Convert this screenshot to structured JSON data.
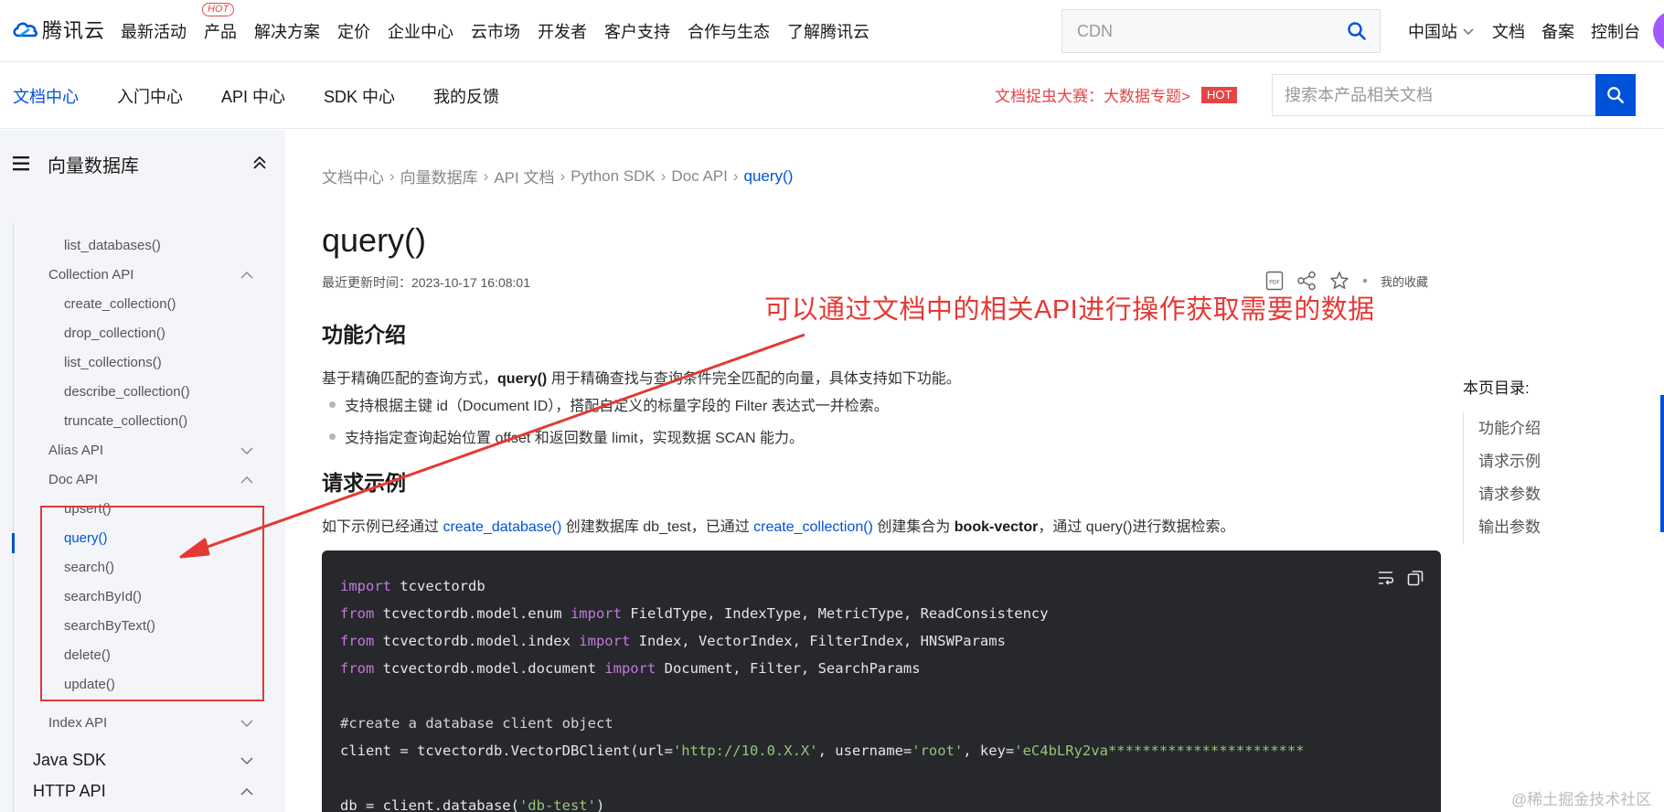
{
  "brand": {
    "name": "腾讯云"
  },
  "topnav": {
    "items": [
      "最新活动",
      "产品",
      "解决方案",
      "定价",
      "企业中心",
      "云市场",
      "开发者",
      "客户支持",
      "合作与生态",
      "了解腾讯云"
    ],
    "hot_badge": "HOT",
    "search_placeholder": "CDN",
    "right": [
      "中国站",
      "文档",
      "备案",
      "控制台"
    ]
  },
  "subnav": {
    "items": [
      "文档中心",
      "入门中心",
      "API 中心",
      "SDK 中心",
      "我的反馈"
    ],
    "active": "文档中心",
    "promo": "文档捉虫大赛：大数据专题>",
    "promo_badge": "HOT",
    "search_placeholder": "搜索本产品相关文档"
  },
  "sidebar": {
    "title": "向量数据库",
    "items": {
      "list_databases": "list_databases()",
      "collection_api": "Collection API",
      "create_collection": "create_collection()",
      "drop_collection": "drop_collection()",
      "list_collections": "list_collections()",
      "describe_collection": "describe_collection()",
      "truncate_collection": "truncate_collection()",
      "alias_api": "Alias API",
      "doc_api": "Doc API",
      "upsert": "upsert()",
      "query": "query()",
      "search": "search()",
      "searchById": "searchById()",
      "searchByText": "searchByText()",
      "delete": "delete()",
      "update": "update()",
      "index_api": "Index API",
      "java_sdk": "Java SDK",
      "http_api": "HTTP API"
    }
  },
  "breadcrumb": [
    "文档中心",
    "向量数据库",
    "API 文档",
    "Python SDK",
    "Doc API",
    "query()"
  ],
  "article": {
    "title": "query()",
    "updated": "最近更新时间：2023-10-17 16:08:01",
    "favorite_label": "我的收藏",
    "h_intro": "功能介绍",
    "intro_pre": "基于精确匹配的查询方式，",
    "intro_bold": "query()",
    "intro_post": " 用于精确查找与查询条件完全匹配的向量，具体支持如下功能。",
    "bullet1": "支持根据主键 id（Document ID），搭配自定义的标量字段的 Filter 表达式一并检索。",
    "bullet2": "支持指定查询起始位置 offset 和返回数量 limit，实现数据 SCAN 能力。",
    "h_example": "请求示例",
    "ex_1": "如下示例已经通过 ",
    "ex_link1": "create_database()",
    "ex_2": " 创建数据库 db_test，已通过 ",
    "ex_link2": "create_collection()",
    "ex_3": " 创建集合为 ",
    "ex_bold": "book-vector",
    "ex_4": "，通过 query()进行数据检索。"
  },
  "code": {
    "kw_import": "import",
    "kw_from": "from",
    "l1_mod": " tcvectordb",
    "l2_mod": " tcvectordb.model.enum ",
    "l2_names": " FieldType, IndexType, MetricType, ReadConsistency",
    "l3_mod": " tcvectordb.model.index ",
    "l3_names": " Index, VectorIndex, FilterIndex, HNSWParams",
    "l4_mod": " tcvectordb.model.document ",
    "l4_names": " Document, Filter, SearchParams",
    "comment": "#create a database client object",
    "l6_a": "client = tcvectordb.VectorDBClient(url=",
    "l6_url": "'http://10.0.X.X'",
    "l6_b": ", username=",
    "l6_user": "'root'",
    "l6_c": ", key=",
    "l6_key": "'eC4bLRy2va***********************",
    "l8_a": "db = client.database(",
    "l8_db": "'db-test'",
    "l8_b": ")"
  },
  "annotation": "可以通过文档中的相关API进行操作获取需要的数据",
  "toc": {
    "title": "本页目录:",
    "items": [
      "功能介绍",
      "请求示例",
      "请求参数",
      "输出参数"
    ]
  },
  "watermark": "@稀土掘金技术社区",
  "colors": {
    "accent": "#0052d9",
    "annotation_red": "#e53935",
    "code_bg": "#26282c"
  }
}
